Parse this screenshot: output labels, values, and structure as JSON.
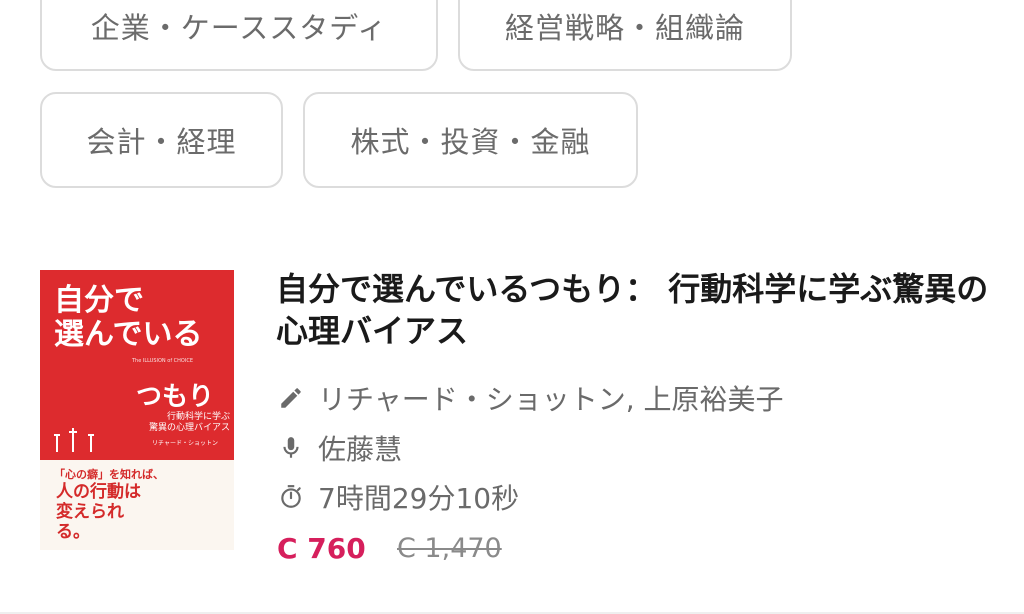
{
  "categories": [
    {
      "label": "企業・ケーススタディ"
    },
    {
      "label": "経営戦略・組織論"
    },
    {
      "label": "会計・経理"
    },
    {
      "label": "株式・投資・金融"
    }
  ],
  "book": {
    "cover": {
      "title_line1": "自分で",
      "title_line2": "選んでいる",
      "title_line3": "つもり",
      "english_title": "The ILLUSION of CHOICE",
      "subtitle_line1": "行動科学に学ぶ",
      "subtitle_line2": "驚異の心理バイアス",
      "author_small": "リチャード・ショットン",
      "tagline1": "「心の癖」を知れば、",
      "tagline2": "人の行動は変えられる。"
    },
    "title": "自分で選んでいるつもり： 行動科学に学ぶ驚異の心理バイアス",
    "authors": "リチャード・ショットン, 上原裕美子",
    "narrator": "佐藤慧",
    "duration": "7時間29分10秒",
    "price": "C 760",
    "original_price": "C 1,470"
  },
  "icons": {
    "author": "pencil-icon",
    "narrator": "microphone-icon",
    "duration": "stopwatch-icon"
  },
  "colors": {
    "price": "#d61f5c",
    "cover_red": "#dd2b2e",
    "chip_border": "#dcdcdc",
    "meta_text": "#6a6a6a"
  }
}
